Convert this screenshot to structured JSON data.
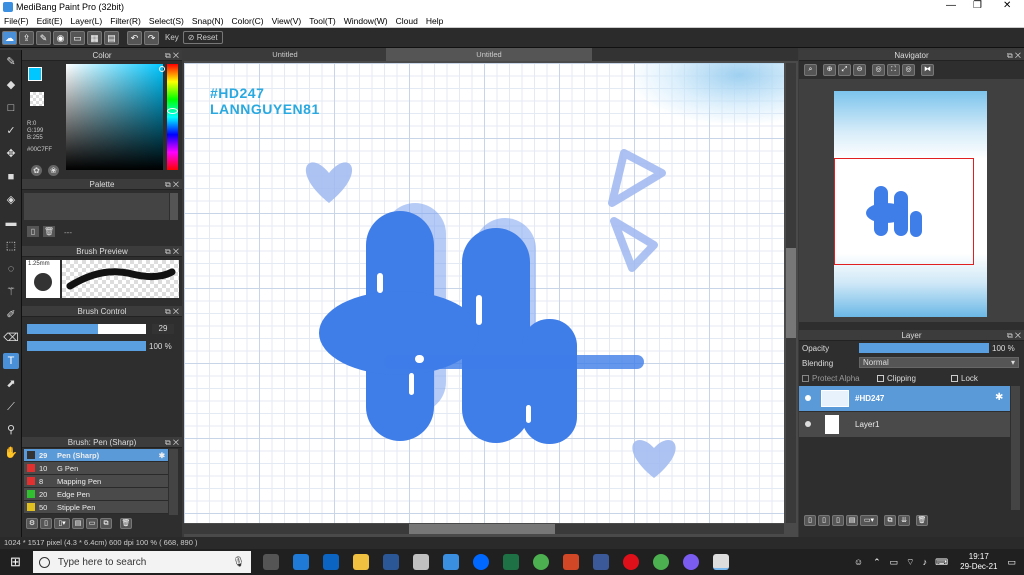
{
  "window": {
    "title": "MediBang Paint Pro (32bit)",
    "minimize": "—",
    "maximize": "❐",
    "close": "✕"
  },
  "menu": [
    "File(F)",
    "Edit(E)",
    "Layer(L)",
    "Filter(R)",
    "Select(S)",
    "Snap(N)",
    "Color(C)",
    "View(V)",
    "Tool(T)",
    "Window(W)",
    "Cloud",
    "Help"
  ],
  "toolbar": {
    "key_label": "Key",
    "reset_label": "Reset"
  },
  "color_panel": {
    "title": "Color",
    "r": "R:0",
    "g": "G:199",
    "b": "B:255",
    "hex": "#00C7FF",
    "fg": "#00c7ff"
  },
  "palette_panel": {
    "title": "Palette",
    "dash": "---"
  },
  "brush_preview": {
    "title": "Brush Preview",
    "size": "1.25mm"
  },
  "brush_control": {
    "title": "Brush Control",
    "size_value": "29",
    "opacity_value": "100 %",
    "size_fill": 0.6,
    "opacity_fill": 1.0
  },
  "brush_list": {
    "title": "Brush: Pen (Sharp)",
    "items": [
      {
        "size": "29",
        "name": "Pen (Sharp)",
        "color": "#333333",
        "selected": true
      },
      {
        "size": "10",
        "name": "G Pen",
        "color": "#e03030",
        "selected": false
      },
      {
        "size": "8",
        "name": "Mapping Pen",
        "color": "#e03030",
        "selected": false
      },
      {
        "size": "20",
        "name": "Edge Pen",
        "color": "#30c030",
        "selected": false
      },
      {
        "size": "50",
        "name": "Stipple Pen",
        "color": "#e0c020",
        "selected": false
      }
    ]
  },
  "canvas": {
    "tab1": "Untitled",
    "tab2": "Untitled",
    "watermark_line1": "#HD247",
    "watermark_line2": "LANNGUYEN81"
  },
  "navigator": {
    "title": "Navigator"
  },
  "layer_panel": {
    "title": "Layer",
    "opacity_label": "Opacity",
    "opacity_value": "100 %",
    "opacity_fill": 1.0,
    "blending_label": "Blending",
    "blending_value": "Normal",
    "protect_alpha": "Protect Alpha",
    "clipping": "Clipping",
    "lock": "Lock",
    "layers": [
      {
        "name": "#HD247",
        "selected": true
      },
      {
        "name": "Layer1",
        "selected": false
      }
    ]
  },
  "status": {
    "text": "1024 * 1517 pixel   (4.3 * 6.4cm)   600 dpi   100 %   ( 668, 890 )"
  },
  "taskbar": {
    "search_placeholder": "Type here to search",
    "time": "19:17",
    "date": "29-Dec-21"
  },
  "colors": {
    "accent": "#4a90d9",
    "panel": "#2e2e2e",
    "drawing": "#3f7de8"
  }
}
